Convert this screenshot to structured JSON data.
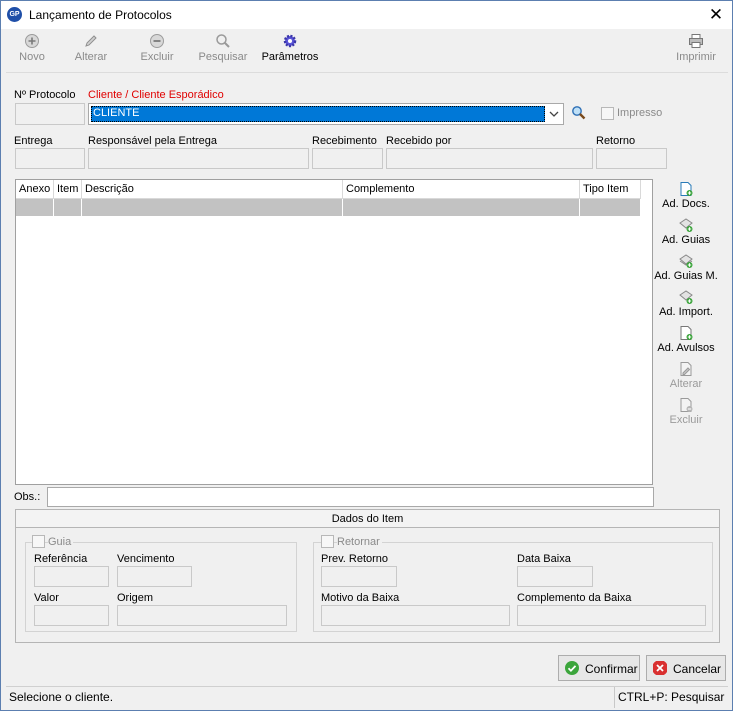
{
  "window": {
    "title": "Lançamento de Protocolos",
    "app_icon_text": "GP",
    "close_glyph": "✕"
  },
  "toolbar": {
    "novo": "Novo",
    "alterar": "Alterar",
    "excluir": "Excluir",
    "pesquisar": "Pesquisar",
    "parametros": "Parâmetros",
    "imprimir": "Imprimir"
  },
  "form": {
    "protocolo_label": "Nº Protocolo",
    "cliente_label": "Cliente / Cliente Esporádico",
    "cliente_value": "CLIENTE",
    "impresso_label": "Impresso",
    "entrega_label": "Entrega",
    "responsavel_label": "Responsável pela Entrega",
    "recebimento_label": "Recebimento",
    "recebido_por_label": "Recebido por",
    "retorno_label": "Retorno",
    "obs_label": "Obs.:"
  },
  "grid": {
    "columns": [
      "Anexo",
      "Item",
      "Descrição",
      "Complemento",
      "Tipo Item"
    ]
  },
  "side_buttons": {
    "ad_docs": "Ad. Docs.",
    "ad_guias": "Ad. Guias",
    "ad_guias_m": "Ad. Guias M.",
    "ad_import": "Ad. Import.",
    "ad_avulsos": "Ad. Avulsos",
    "alterar": "Alterar",
    "excluir": "Excluir"
  },
  "dados_item": {
    "title": "Dados do Item",
    "guia_label": "Guia",
    "referencia_label": "Referência",
    "vencimento_label": "Vencimento",
    "valor_label": "Valor",
    "origem_label": "Origem",
    "retornar_label": "Retornar",
    "prev_retorno_label": "Prev. Retorno",
    "data_baixa_label": "Data Baixa",
    "motivo_baixa_label": "Motivo da Baixa",
    "complemento_baixa_label": "Complemento da Baixa"
  },
  "buttons": {
    "confirmar": "Confirmar",
    "cancelar": "Cancelar"
  },
  "status": {
    "message": "Selecione o cliente.",
    "shortcut": "CTRL+P: Pesquisar"
  },
  "colors": {
    "accent_red": "#e00000",
    "selection_blue": "#0078d7",
    "disabled_gray": "#8a8a8a"
  }
}
